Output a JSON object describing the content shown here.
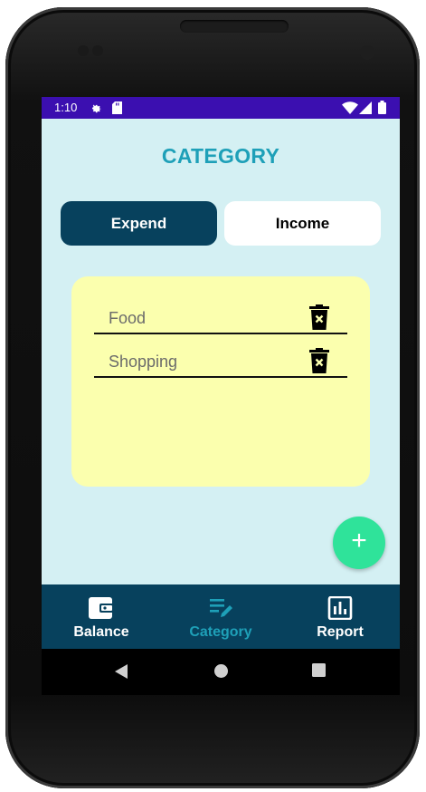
{
  "status_bar": {
    "time": "1:10",
    "icons": [
      "settings-icon",
      "sd-card-icon",
      "wifi-icon",
      "signal-icon",
      "battery-icon"
    ]
  },
  "header": {
    "title": "CATEGORY"
  },
  "tabs": {
    "expend": "Expend",
    "income": "Income",
    "selected": "expend"
  },
  "categories": [
    {
      "name": "Food"
    },
    {
      "name": "Shopping"
    }
  ],
  "fab": {
    "icon": "plus-icon",
    "label": "+"
  },
  "bottom_nav": [
    {
      "label": "Balance",
      "icon": "wallet-icon",
      "active": false
    },
    {
      "label": "Category",
      "icon": "list-edit-icon",
      "active": true
    },
    {
      "label": "Report",
      "icon": "bar-chart-icon",
      "active": false
    }
  ],
  "system_nav": [
    "back-icon",
    "home-icon",
    "recents-icon"
  ],
  "colors": {
    "status_bar": "#3b0fb0",
    "background": "#d4f0f3",
    "accent": "#1ea0b8",
    "dark": "#07415d",
    "card": "#fbffae",
    "fab": "#2fe39a"
  }
}
